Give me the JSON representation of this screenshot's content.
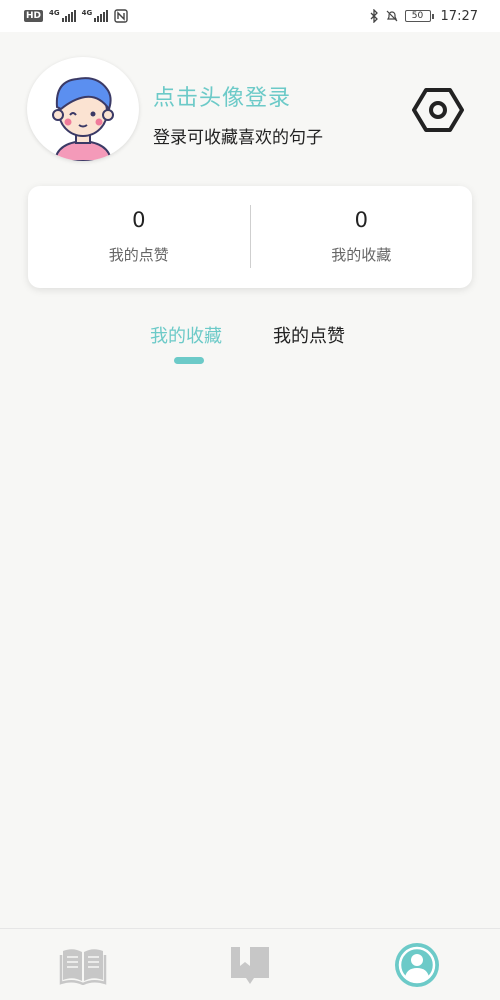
{
  "status_bar": {
    "hd_label": "HD",
    "network_1": "4G",
    "network_2": "4G",
    "battery": "50",
    "time": "17:27"
  },
  "profile": {
    "login_title": "点击头像登录",
    "login_subtitle": "登录可收藏喜欢的句子",
    "avatar_icon": "cartoon-avatar",
    "settings_icon": "settings-hex-icon"
  },
  "stats": {
    "likes_count": "0",
    "likes_label": "我的点赞",
    "favorites_count": "0",
    "favorites_label": "我的收藏"
  },
  "tabs": [
    {
      "label": "我的收藏",
      "active": true
    },
    {
      "label": "我的点赞",
      "active": false
    }
  ],
  "bottom_nav": [
    {
      "icon": "book-icon",
      "active": false
    },
    {
      "icon": "bookmark-icon",
      "active": false
    },
    {
      "icon": "profile-icon",
      "active": true
    }
  ],
  "colors": {
    "accent": "#6ccac8",
    "background": "#f7f7f5",
    "nav_inactive": "#c7c7c7"
  }
}
